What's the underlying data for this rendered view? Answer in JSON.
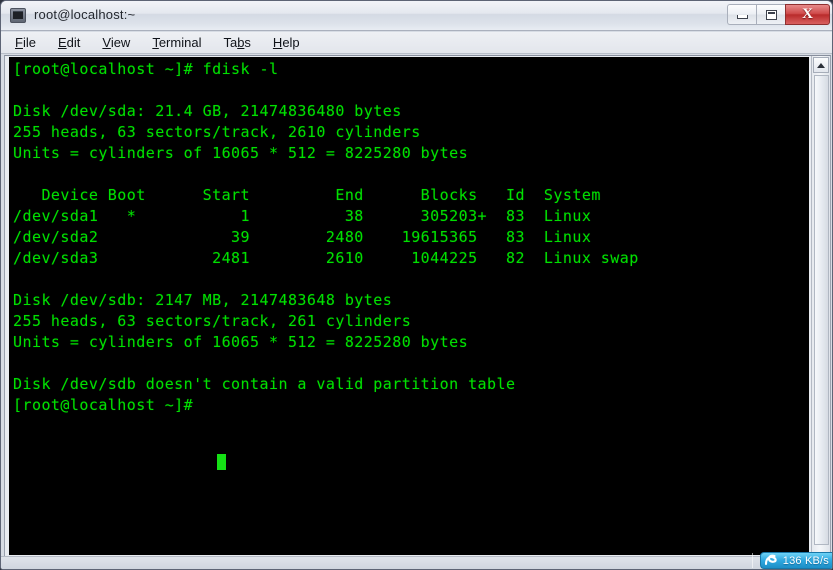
{
  "window": {
    "title": "root@localhost:~",
    "icon": "terminal-icon",
    "controls": {
      "minimize_label": "–",
      "maximize_label": "□",
      "close_label": "X"
    }
  },
  "menubar": {
    "items": [
      {
        "label": "File",
        "mnemonic": "F",
        "rest": "ile"
      },
      {
        "label": "Edit",
        "mnemonic": "E",
        "rest": "dit"
      },
      {
        "label": "View",
        "mnemonic": "V",
        "rest": "iew"
      },
      {
        "label": "Terminal",
        "mnemonic": "T",
        "rest": "erminal"
      },
      {
        "label": "Tabs",
        "pre": "Ta",
        "mnemonic": "b",
        "rest": "s"
      },
      {
        "label": "Help",
        "mnemonic": "H",
        "rest": "elp"
      }
    ]
  },
  "terminal": {
    "foreground_color": "#00e000",
    "background_color": "#000000",
    "prompt": "[root@localhost ~]#",
    "command": "fdisk -l",
    "cursor": "block",
    "content": "[root@localhost ~]# fdisk -l\n\nDisk /dev/sda: 21.4 GB, 21474836480 bytes\n255 heads, 63 sectors/track, 2610 cylinders\nUnits = cylinders of 16065 * 512 = 8225280 bytes\n\n   Device Boot      Start         End      Blocks   Id  System\n/dev/sda1   *           1          38      305203+  83  Linux\n/dev/sda2              39        2480    19615365   83  Linux\n/dev/sda3            2481        2610     1044225   82  Linux swap\n\nDisk /dev/sdb: 2147 MB, 2147483648 bytes\n255 heads, 63 sectors/track, 261 cylinders\nUnits = cylinders of 16065 * 512 = 8225280 bytes\n\nDisk /dev/sdb doesn't contain a valid partition table\n[root@localhost ~]# ",
    "disks": [
      {
        "device": "/dev/sda",
        "size_human": "21.4 GB",
        "size_bytes": "21474836480 bytes",
        "heads": "255",
        "sectors_per_track": "63",
        "cylinders": "2610",
        "units": "cylinders of 16065 * 512 = 8225280 bytes",
        "table_headers": [
          "Device",
          "Boot",
          "Start",
          "End",
          "Blocks",
          "Id",
          "System"
        ],
        "partitions": [
          {
            "device": "/dev/sda1",
            "boot": "*",
            "start": "1",
            "end": "38",
            "blocks": "305203+",
            "id": "83",
            "system": "Linux"
          },
          {
            "device": "/dev/sda2",
            "boot": "",
            "start": "39",
            "end": "2480",
            "blocks": "19615365",
            "id": "83",
            "system": "Linux"
          },
          {
            "device": "/dev/sda3",
            "boot": "",
            "start": "2481",
            "end": "2610",
            "blocks": "1044225",
            "id": "82",
            "system": "Linux swap"
          }
        ]
      },
      {
        "device": "/dev/sdb",
        "size_human": "2147 MB",
        "size_bytes": "2147483648 bytes",
        "heads": "255",
        "sectors_per_track": "63",
        "cylinders": "261",
        "units": "cylinders of 16065 * 512 = 8225280 bytes",
        "message": "Disk /dev/sdb doesn't contain a valid partition table",
        "partitions": []
      }
    ]
  },
  "statusbar": {
    "network_widget": {
      "icon": "network-speed-icon",
      "speed": "136 KB/s",
      "accent_color": "#2ea8e0"
    }
  }
}
